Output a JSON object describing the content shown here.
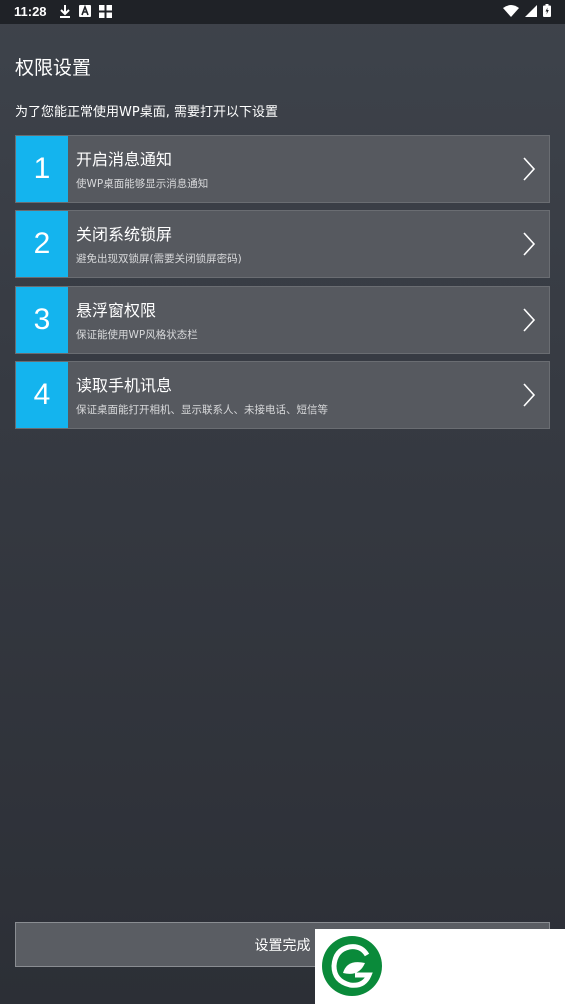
{
  "status_bar": {
    "time": "11:28",
    "left_icons": [
      "download-icon",
      "a-badge-icon",
      "grid-app-icon"
    ],
    "right_icons": [
      "wifi-icon",
      "signal-icon",
      "battery-icon"
    ]
  },
  "page": {
    "title": "权限设置",
    "subtitle": "为了您能正常使用WP桌面, 需要打开以下设置"
  },
  "items": [
    {
      "num": "1",
      "title": "开启消息通知",
      "desc": "使WP桌面能够显示消息通知"
    },
    {
      "num": "2",
      "title": "关闭系统锁屏",
      "desc": "避免出现双锁屏(需要关闭锁屏密码)"
    },
    {
      "num": "3",
      "title": "悬浮窗权限",
      "desc": "保证能使用WP风格状态栏"
    },
    {
      "num": "4",
      "title": "读取手机讯息",
      "desc": "保证桌面能打开相机、显示联系人、未接电话、短信等"
    }
  ],
  "footer": {
    "done_label": "设置完成"
  },
  "colors": {
    "accent": "#14b4ee",
    "item_bg": "#56595f",
    "logo_green": "#0a8a3a"
  }
}
